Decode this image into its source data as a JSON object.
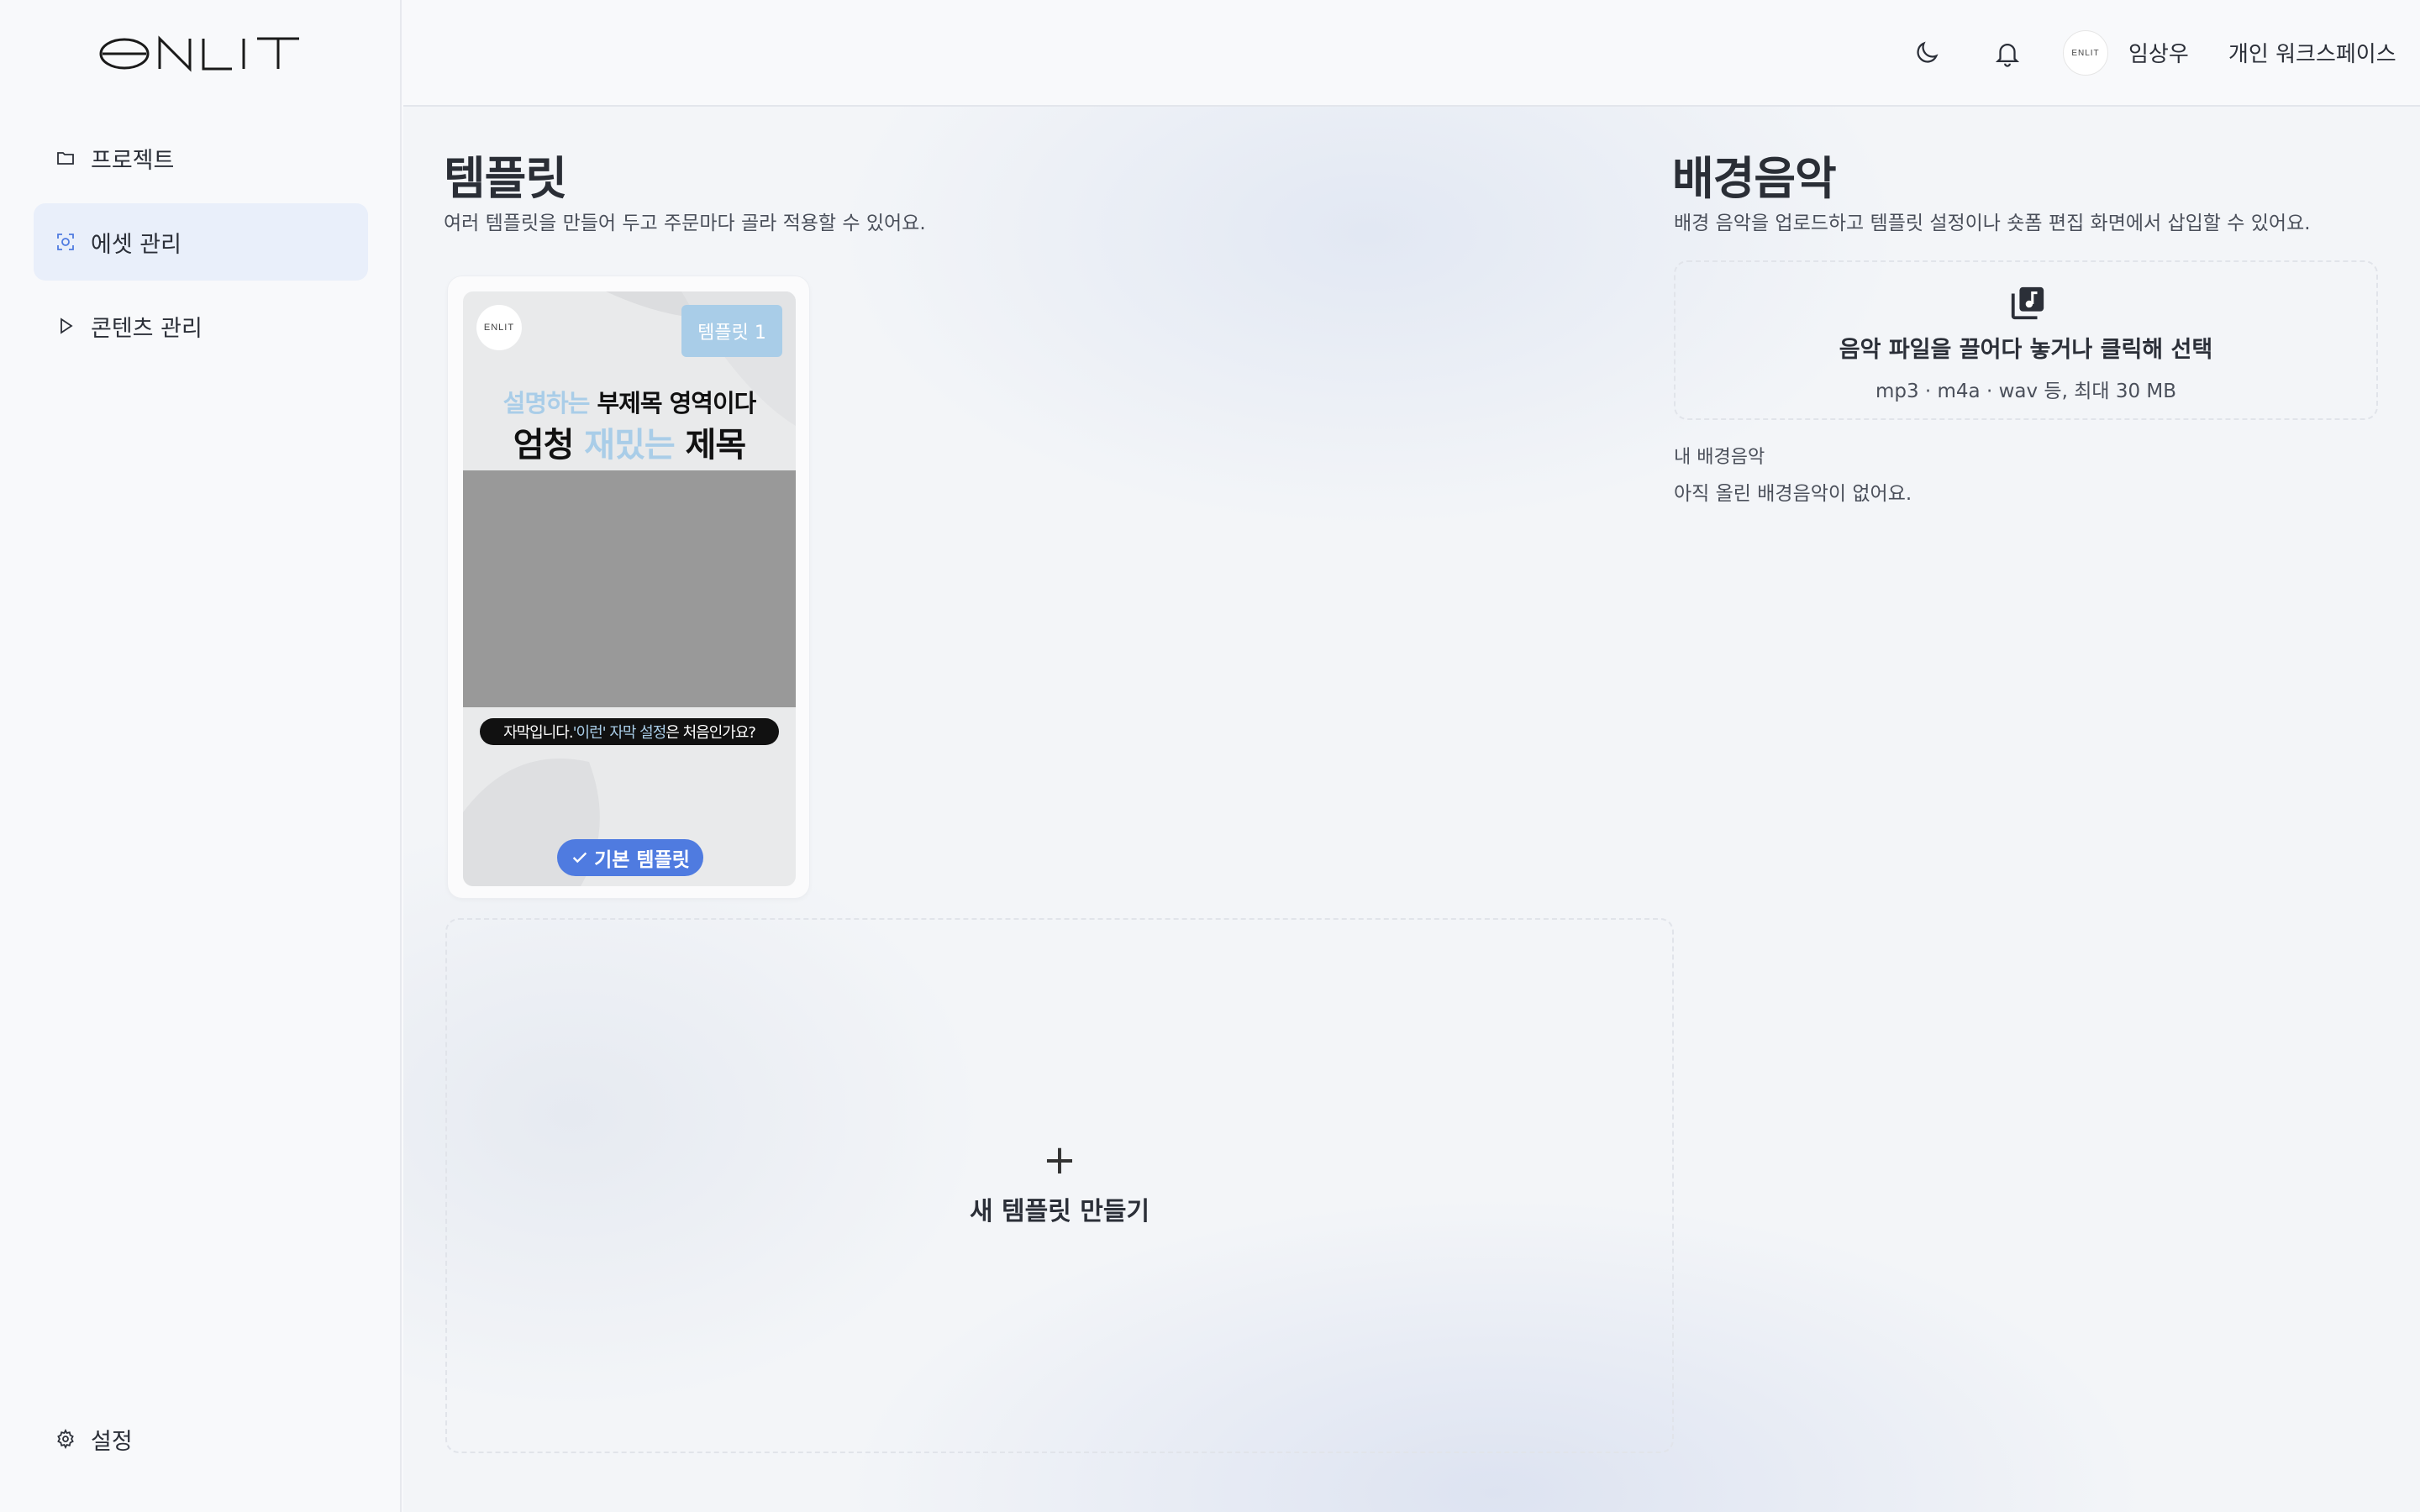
{
  "app": {
    "logo_text": "ENLIT"
  },
  "sidebar": {
    "items": [
      {
        "label": "프로젝트",
        "icon": "folder-icon"
      },
      {
        "label": "에셋 관리",
        "icon": "asset-scan-icon",
        "active": true
      },
      {
        "label": "콘텐츠 관리",
        "icon": "play-icon"
      }
    ],
    "settings_label": "설정"
  },
  "topbar": {
    "theme_icon": "moon-icon",
    "notification_icon": "bell-icon",
    "avatar_text": "ENLIT",
    "user_name": "임상우",
    "workspace": "개인 워크스페이스"
  },
  "templates": {
    "title": "템플릿",
    "description": "여러 템플릿을 만들어 두고 주문마다 골라 적용할 수 있어요.",
    "cards": [
      {
        "logo_text": "ENLIT",
        "badge": "템플릿 1",
        "subtitle_highlight": "설명하는",
        "subtitle_rest": " 부제목 영역이다",
        "title_pre": "엄청 ",
        "title_highlight": "재밌는",
        "title_post": " 제목",
        "caption_pre": "자막입니다. ",
        "caption_highlight": "'이런' 자막 설정",
        "caption_post": "은 처음인가요?",
        "default_label": "기본 템플릿"
      }
    ],
    "new_plus": "+",
    "new_label": "새 템플릿 만들기"
  },
  "bgm": {
    "title": "배경음악",
    "description": "배경 음악을 업로드하고 템플릿 설정이나 숏폼 편집 화면에서 삽입할 수 있어요.",
    "upload_title": "음악 파일을 끌어다 놓거나 클릭해 선택",
    "upload_hint": "mp3 · m4a · wav 등, 최대 30 MB",
    "list_label": "내 배경음악",
    "empty_text": "아직 올린 배경음악이 없어요."
  },
  "colors": {
    "accent": "#4f7be0",
    "highlight": "#a9cde8",
    "active_nav_bg": "#e9effa"
  }
}
